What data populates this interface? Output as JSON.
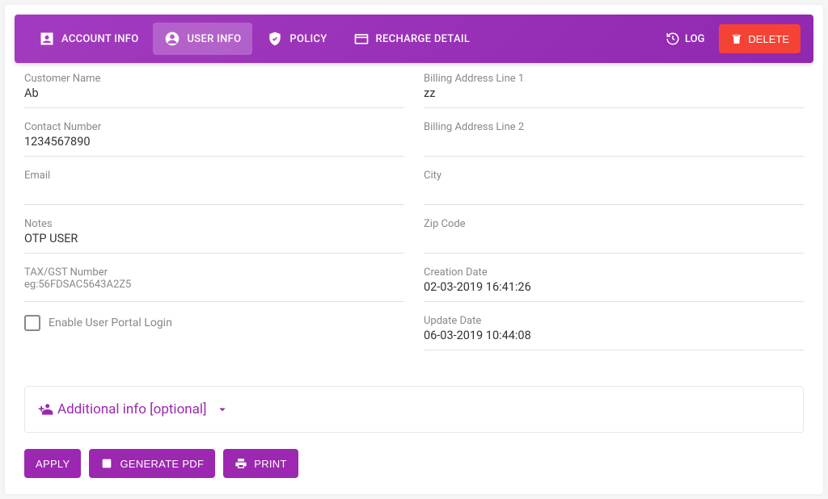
{
  "toolbar": {
    "tabs": [
      {
        "label": "ACCOUNT INFO"
      },
      {
        "label": "USER INFO"
      },
      {
        "label": "POLICY"
      },
      {
        "label": "RECHARGE DETAIL"
      }
    ],
    "log_label": "LOG",
    "delete_label": "DELETE"
  },
  "form": {
    "left": {
      "customer_name": {
        "label": "Customer Name",
        "value": "Ab"
      },
      "contact_number": {
        "label": "Contact Number",
        "value": "1234567890"
      },
      "email": {
        "label": "Email",
        "value": ""
      },
      "notes": {
        "label": "Notes",
        "value": "OTP USER"
      },
      "tax_gst": {
        "label": "TAX/GST Number",
        "sublabel": "eg:56FDSAC5643A2Z5",
        "value": ""
      },
      "enable_portal": {
        "label": "Enable User Portal Login"
      }
    },
    "right": {
      "addr1": {
        "label": "Billing Address Line 1",
        "value": "zz"
      },
      "addr2": {
        "label": "Billing Address Line 2",
        "value": ""
      },
      "city": {
        "label": "City",
        "value": ""
      },
      "zip": {
        "label": "Zip Code",
        "value": ""
      },
      "creation": {
        "label": "Creation Date",
        "value": "02-03-2019 16:41:26"
      },
      "update": {
        "label": "Update Date",
        "value": "06-03-2019 10:44:08"
      }
    }
  },
  "expander": {
    "label": "Additional info [optional]"
  },
  "footer": {
    "apply": "APPLY",
    "generate_pdf": "GENERATE PDF",
    "print": "PRINT"
  }
}
